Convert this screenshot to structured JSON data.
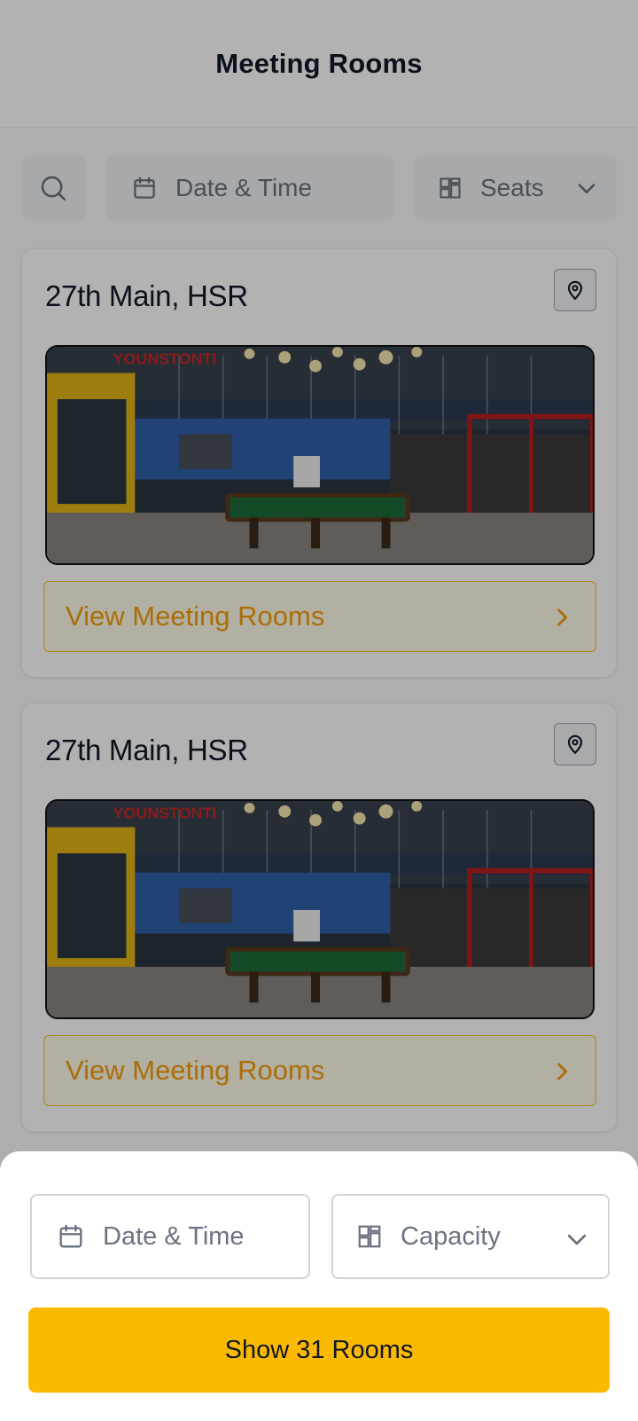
{
  "header": {
    "title": "Meeting Rooms"
  },
  "filters": {
    "search_icon": "search-icon",
    "date_label": "Date & Time",
    "seats_label": "Seats"
  },
  "locations": [
    {
      "name": "27th Main, HSR",
      "cta": "View Meeting Rooms",
      "sign_text": "YOUNSTONTI"
    },
    {
      "name": "27th Main, HSR",
      "cta": "View Meeting Rooms",
      "sign_text": "YOUNSTONTI"
    }
  ],
  "sheet": {
    "date_label": "Date & Time",
    "capacity_label": "Capacity",
    "show_button": "Show 31 Rooms"
  },
  "colors": {
    "accent": "#FBB900",
    "cta_text": "#F59E0B",
    "overlay": "rgba(0,0,0,0.30)"
  }
}
